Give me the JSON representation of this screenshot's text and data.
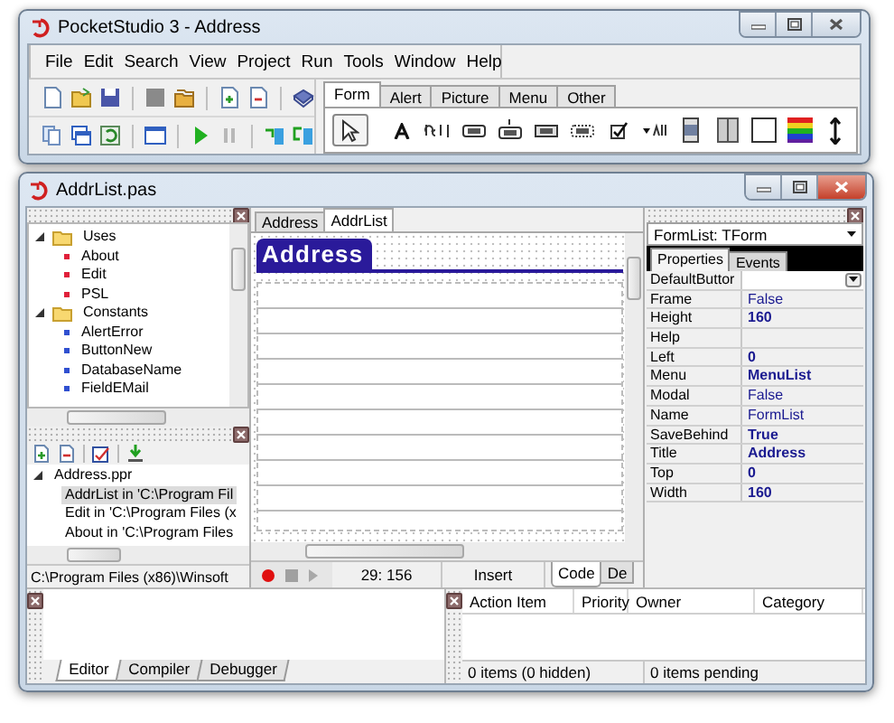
{
  "main_window": {
    "title": "PocketStudio 3 - Address",
    "active": false
  },
  "menu": [
    "File",
    "Edit",
    "Search",
    "View",
    "Project",
    "Run",
    "Tools",
    "Window",
    "Help"
  ],
  "palette": {
    "tabs": [
      {
        "label": "Form",
        "selected": true
      },
      {
        "label": "Alert",
        "selected": false
      },
      {
        "label": "Picture",
        "selected": false
      },
      {
        "label": "Menu",
        "selected": false
      },
      {
        "label": "Other",
        "selected": false
      }
    ],
    "tools": [
      {
        "kind": "pointer",
        "selected": true
      },
      {
        "kind": "label",
        "selected": false
      },
      {
        "kind": "field",
        "selected": false
      },
      {
        "kind": "button",
        "selected": false
      },
      {
        "kind": "graphic-button",
        "selected": false
      },
      {
        "kind": "pushbutton",
        "selected": false
      },
      {
        "kind": "selector",
        "selected": false
      },
      {
        "kind": "checkbox",
        "selected": false
      },
      {
        "kind": "popup",
        "selected": false
      },
      {
        "kind": "scrollbar",
        "selected": false
      },
      {
        "kind": "table",
        "selected": false
      },
      {
        "kind": "gadget",
        "selected": false
      },
      {
        "kind": "bitmap",
        "selected": false
      },
      {
        "kind": "slider",
        "selected": false
      }
    ]
  },
  "editor_window": {
    "title": "AddrList.pas",
    "active": true
  },
  "code_tree": [
    {
      "label": "Uses",
      "expanded": true,
      "children": [
        {
          "label": "About",
          "color": "#e0203a"
        },
        {
          "label": "Edit",
          "color": "#e0203a"
        },
        {
          "label": "PSL",
          "color": "#e0203a"
        }
      ]
    },
    {
      "label": "Constants",
      "expanded": true,
      "children": [
        {
          "label": "AlertError",
          "color": "#3050d0"
        },
        {
          "label": "ButtonNew",
          "color": "#3050d0"
        },
        {
          "label": "DatabaseName",
          "color": "#3050d0"
        },
        {
          "label": "FieldEMail",
          "color": "#3050d0"
        }
      ]
    }
  ],
  "project_tree": [
    {
      "label": "Address.ppr",
      "expanded": true,
      "children": [
        {
          "label": "AddrList in 'C:\\Program Fil",
          "selected": true
        },
        {
          "label": "Edit in 'C:\\Program Files (x",
          "selected": false
        },
        {
          "label": "About in 'C:\\Program Files",
          "selected": false
        }
      ]
    }
  ],
  "path": "C:\\Program Files (x86)\\Winsoft",
  "editor_tabs": [
    {
      "label": "Address",
      "selected": false
    },
    {
      "label": "AddrList",
      "selected": true
    }
  ],
  "form": {
    "title": "Address"
  },
  "position": "29: 156",
  "mode": "Insert",
  "view_tabs": [
    {
      "label": "Code",
      "selected": true
    },
    {
      "label": "De",
      "selected": false
    }
  ],
  "inspector": {
    "object": "FormList: TForm",
    "tabs": [
      {
        "label": "Properties",
        "selected": true
      },
      {
        "label": "Events",
        "selected": false
      }
    ],
    "properties": [
      {
        "name": "DefaultButtor",
        "kind": "dropdown"
      },
      {
        "name": "Frame",
        "value": "False",
        "modified": false,
        "kind": "text"
      },
      {
        "name": "Height",
        "value": "160",
        "modified": true,
        "kind": "text"
      },
      {
        "name": "Help",
        "kind": "text"
      },
      {
        "name": "Left",
        "value": "0",
        "modified": true,
        "kind": "text"
      },
      {
        "name": "Menu",
        "value": "MenuList",
        "modified": true,
        "kind": "text"
      },
      {
        "name": "Modal",
        "value": "False",
        "modified": false,
        "kind": "text"
      },
      {
        "name": "Name",
        "value": "FormList",
        "modified": false,
        "kind": "text"
      },
      {
        "name": "SaveBehind",
        "value": "True",
        "modified": true,
        "kind": "text"
      },
      {
        "name": "Title",
        "value": "Address",
        "modified": true,
        "kind": "text"
      },
      {
        "name": "Top",
        "value": "0",
        "modified": true,
        "kind": "text"
      },
      {
        "name": "Width",
        "value": "160",
        "modified": true,
        "kind": "text"
      }
    ]
  },
  "messages": {
    "tabs": [
      {
        "label": "Editor",
        "selected": true
      },
      {
        "label": "Compiler",
        "selected": false
      },
      {
        "label": "Debugger",
        "selected": false
      }
    ]
  },
  "todo": {
    "columns": [
      "Action Item",
      "Priority",
      "Owner",
      "Category"
    ],
    "status": [
      "0 items (0 hidden)",
      "0 items pending"
    ]
  }
}
